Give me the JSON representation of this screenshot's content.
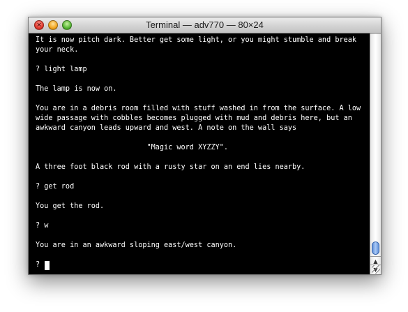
{
  "window": {
    "title": "Terminal — adv770 — 80×24"
  },
  "terminal": {
    "lines": [
      "It is now pitch dark. Better get some light, or you might stumble and break",
      "your neck.",
      "",
      "? light lamp",
      "",
      "The lamp is now on.",
      "",
      "You are in a debris room filled with stuff washed in from the surface. A low",
      "wide passage with cobbles becomes plugged with mud and debris here, but an",
      "awkward canyon leads upward and west. A note on the wall says",
      "",
      "                          \"Magic word XYZZY\".",
      "",
      "A three foot black rod with a rusty star on an end lies nearby.",
      "",
      "? get rod",
      "",
      "You get the rod.",
      "",
      "? w",
      "",
      "You are in an awkward sloping east/west canyon.",
      "",
      "? "
    ]
  },
  "colors": {
    "background": "#000000",
    "text": "#ffffff",
    "scroll_thumb": "#7aa7e9"
  },
  "icons": {
    "close": "close-icon",
    "minimize": "minimize-icon",
    "zoom": "zoom-icon",
    "scroll_up": "arrow-up-icon",
    "scroll_down": "arrow-down-icon",
    "resize": "resize-grip-icon"
  }
}
